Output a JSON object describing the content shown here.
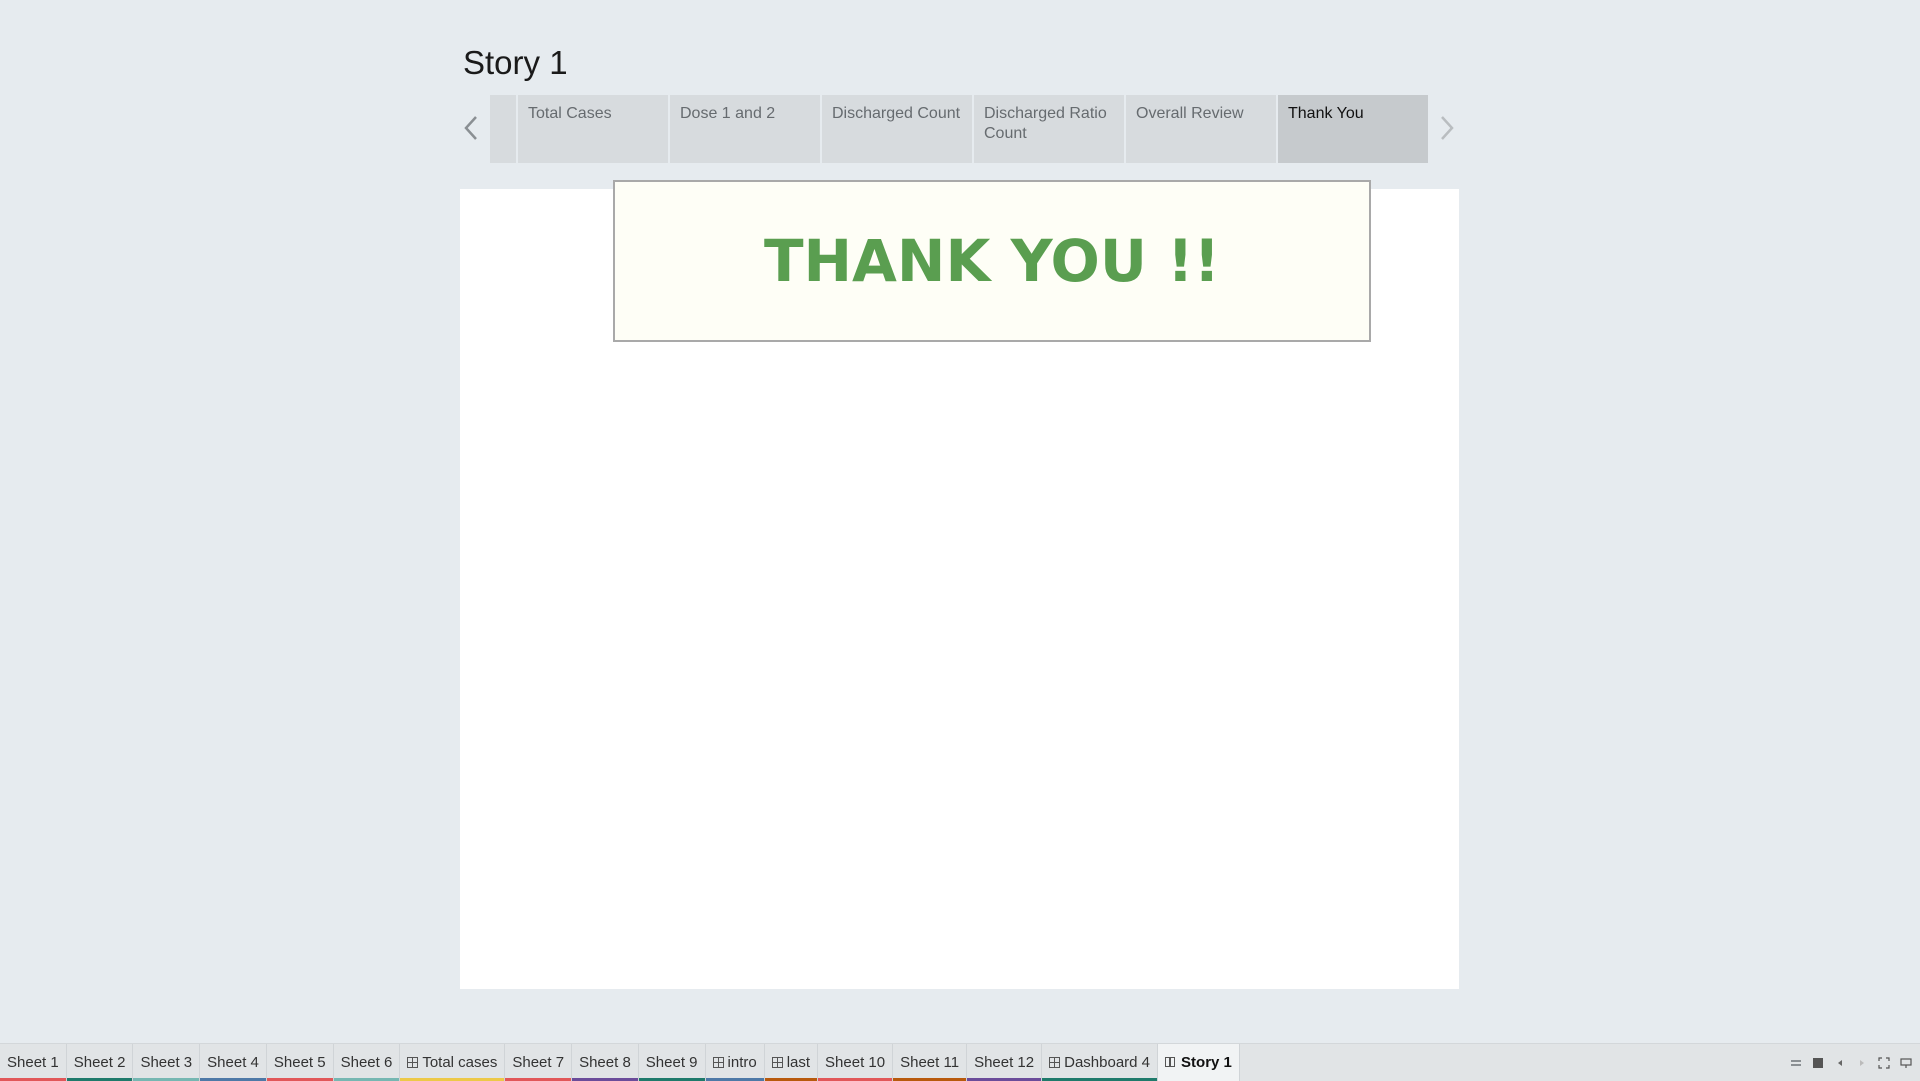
{
  "story": {
    "title": "Story 1"
  },
  "story_points": [
    {
      "label": "Total Cases",
      "active": false
    },
    {
      "label": "Dose 1 and 2",
      "active": false
    },
    {
      "label": "Discharged Count",
      "active": false
    },
    {
      "label": "Discharged Ratio Count",
      "active": false
    },
    {
      "label": "Overall Review",
      "active": false
    },
    {
      "label": "Thank You",
      "active": true
    }
  ],
  "content": {
    "thank_you_text": "THANK YOU !!",
    "text_color": "#5a9e50",
    "box_background": "#fefef6"
  },
  "tabs": [
    {
      "label": "Sheet 1",
      "icon": null,
      "color": "#e15759"
    },
    {
      "label": "Sheet 2",
      "icon": null,
      "color": "#1f7a6b"
    },
    {
      "label": "Sheet 3",
      "icon": null,
      "color": "#76b7b2"
    },
    {
      "label": "Sheet 4",
      "icon": null,
      "color": "#4e79a7"
    },
    {
      "label": "Sheet 5",
      "icon": null,
      "color": "#e15759"
    },
    {
      "label": "Sheet 6",
      "icon": null,
      "color": "#76b7b2"
    },
    {
      "label": "Total cases",
      "icon": "dashboard-icon",
      "color": "#edc948"
    },
    {
      "label": "Sheet 7",
      "icon": null,
      "color": "#e15759"
    },
    {
      "label": "Sheet 8",
      "icon": null,
      "color": "#6b4c9a"
    },
    {
      "label": "Sheet 9",
      "icon": null,
      "color": "#1f7a6b"
    },
    {
      "label": "intro",
      "icon": "dashboard-icon",
      "color": "#4e79a7"
    },
    {
      "label": "last",
      "icon": "dashboard-icon",
      "color": "#b85a0d"
    },
    {
      "label": "Sheet 10",
      "icon": null,
      "color": "#e15759"
    },
    {
      "label": "Sheet 11",
      "icon": null,
      "color": "#b85a0d"
    },
    {
      "label": "Sheet 12",
      "icon": null,
      "color": "#6b4c9a"
    },
    {
      "label": "Dashboard 4",
      "icon": "dashboard-icon",
      "color": "#1f7a6b"
    },
    {
      "label": "Story 1",
      "icon": "story-icon",
      "color": null,
      "active": true
    }
  ],
  "controls": [
    "show-sheet-sorter-icon",
    "show-filmstrip-icon",
    "previous-sheet-icon",
    "next-sheet-icon",
    "presentation-mode-icon",
    "present-icon"
  ]
}
